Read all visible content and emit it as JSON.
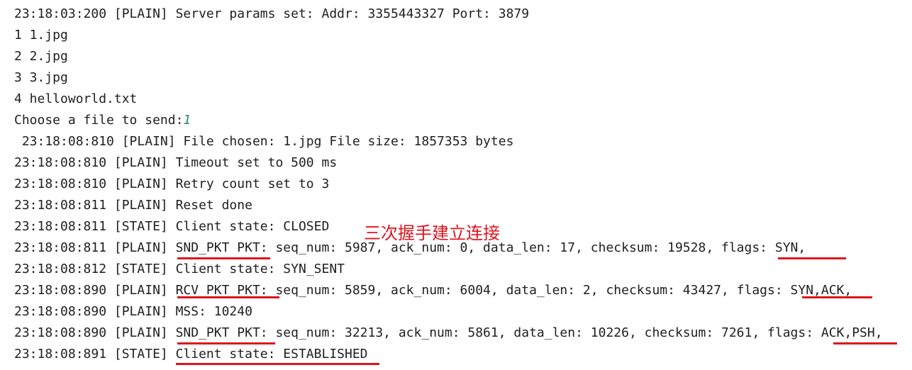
{
  "console": {
    "lines": [
      "23:18:03:200 [PLAIN] Server params set: Addr: 3355443327 Port: 3879",
      "1 1.jpg",
      "2 2.jpg",
      "3 3.jpg",
      "4 helloworld.txt",
      "Choose a file to send:",
      " 23:18:08:810 [PLAIN] File chosen: 1.jpg File size: 1857353 bytes",
      "23:18:08:810 [PLAIN] Timeout set to 500 ms",
      "23:18:08:810 [PLAIN] Retry count set to 3",
      "23:18:08:811 [PLAIN] Reset done",
      "23:18:08:811 [STATE] Client state: CLOSED",
      "23:18:08:811 [PLAIN] SND_PKT PKT: seq_num: 5987, ack_num: 0, data_len: 17, checksum: 19528, flags: SYN,",
      "23:18:08:812 [STATE] Client state: SYN_SENT",
      "23:18:08:890 [PLAIN] RCV_PKT PKT: seq_num: 5859, ack_num: 6004, data_len: 2, checksum: 43427, flags: SYN,ACK,",
      "23:18:08:890 [PLAIN] MSS: 10240",
      "23:18:08:890 [PLAIN] SND_PKT PKT: seq_num: 32213, ack_num: 5861, data_len: 10226, checksum: 7261, flags: ACK,PSH,",
      "23:18:08:891 [STATE] Client state: ESTABLISHED"
    ],
    "user_input": "1"
  },
  "annotation": {
    "text": "三次握手建立连接",
    "color": "#e0141e"
  }
}
